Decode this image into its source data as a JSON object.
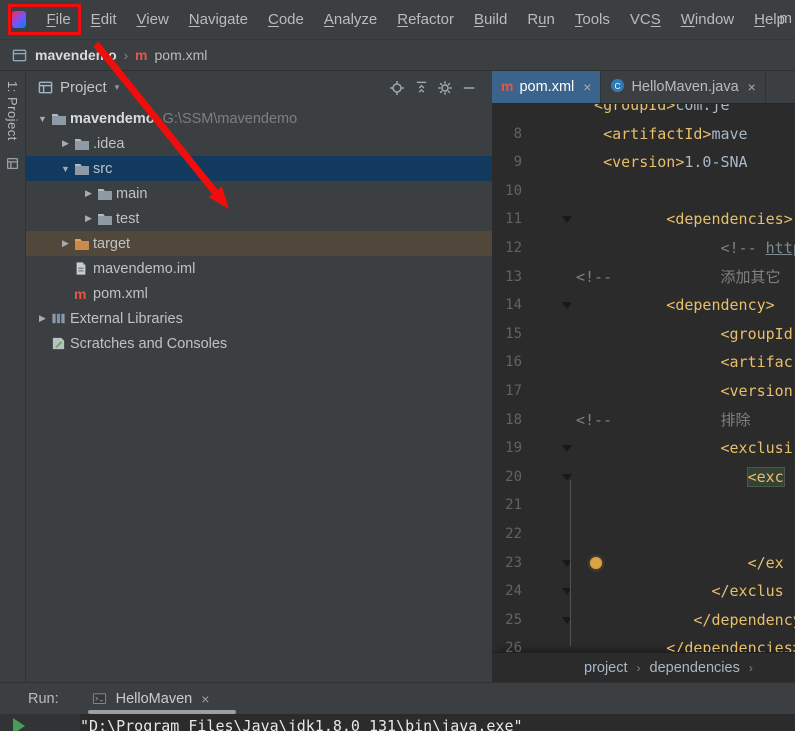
{
  "icons": {
    "close": "×",
    "chevron": "›",
    "caret": "▾",
    "expanded": "▼",
    "collapsed": "▶"
  },
  "menu": {
    "items": [
      {
        "label": "File",
        "mnemonic": "F"
      },
      {
        "label": "Edit",
        "mnemonic": "E"
      },
      {
        "label": "View",
        "mnemonic": "V"
      },
      {
        "label": "Navigate",
        "mnemonic": "N"
      },
      {
        "label": "Code",
        "mnemonic": "C"
      },
      {
        "label": "Analyze",
        "mnemonic": "A"
      },
      {
        "label": "Refactor",
        "mnemonic": "R"
      },
      {
        "label": "Build",
        "mnemonic": "B"
      },
      {
        "label": "Run",
        "mnemonic": "u"
      },
      {
        "label": "Tools",
        "mnemonic": "T"
      },
      {
        "label": "VCS",
        "mnemonic": "S"
      },
      {
        "label": "Window",
        "mnemonic": "W"
      },
      {
        "label": "Help",
        "mnemonic": "H"
      }
    ],
    "overflow": "m"
  },
  "breadcrumb": {
    "project": "mavendemo",
    "file": "pom.xml"
  },
  "stripe": {
    "project_label": "1: Project"
  },
  "project": {
    "title": "Project",
    "tree": [
      {
        "label": "mavendemo",
        "hint": "G:\\SSM\\mavendemo",
        "level": 0,
        "arrow": "down",
        "icon": "folder",
        "bold": true
      },
      {
        "label": ".idea",
        "level": 1,
        "arrow": "right",
        "icon": "folder"
      },
      {
        "label": "src",
        "level": 1,
        "arrow": "down",
        "icon": "folder",
        "state": "selected"
      },
      {
        "label": "main",
        "level": 2,
        "arrow": "right",
        "icon": "folder"
      },
      {
        "label": "test",
        "level": 2,
        "arrow": "right",
        "icon": "folder"
      },
      {
        "label": "target",
        "level": 1,
        "arrow": "right",
        "icon": "folder-excluded",
        "state": "excluded"
      },
      {
        "label": "mavendemo.iml",
        "level": 1,
        "arrow": "none",
        "icon": "file"
      },
      {
        "label": "pom.xml",
        "level": 1,
        "arrow": "none",
        "icon": "maven"
      },
      {
        "label": "External Libraries",
        "level": 0,
        "arrow": "right",
        "icon": "libraries"
      },
      {
        "label": "Scratches and Consoles",
        "level": 0,
        "arrow": "none",
        "icon": "scratches"
      }
    ]
  },
  "editor": {
    "tabs": [
      {
        "label": "pom.xml",
        "icon": "maven",
        "selected": true
      },
      {
        "label": "HelloMaven.java",
        "icon": "class",
        "selected": false
      }
    ],
    "lines": [
      {
        "num": "",
        "indent": 2,
        "segs": [
          [
            "<groupId>",
            "tag"
          ],
          [
            "com.je",
            "plain"
          ]
        ]
      },
      {
        "num": "8",
        "indent": 3,
        "segs": [
          [
            "<artifactId>",
            "tag"
          ],
          [
            "mave",
            "plain"
          ]
        ]
      },
      {
        "num": "9",
        "indent": 3,
        "segs": [
          [
            "<version>",
            "tag"
          ],
          [
            "1.0-SNA",
            "plain"
          ]
        ]
      },
      {
        "num": "10",
        "indent": 0,
        "segs": []
      },
      {
        "num": "11",
        "indent": 10,
        "fold": true,
        "segs": [
          [
            "<dependencies>",
            "tag"
          ]
        ]
      },
      {
        "num": "12",
        "indent": 16,
        "segs": [
          [
            "<!-- ",
            "comment"
          ],
          [
            "https:/",
            "link"
          ]
        ]
      },
      {
        "num": "13",
        "indent": 0,
        "segs": [
          [
            "<!--            添加其它",
            "comment"
          ]
        ]
      },
      {
        "num": "14",
        "indent": 10,
        "fold": true,
        "segs": [
          [
            "<dependency>",
            "tag"
          ]
        ]
      },
      {
        "num": "15",
        "indent": 16,
        "segs": [
          [
            "<groupId",
            "tag"
          ]
        ]
      },
      {
        "num": "16",
        "indent": 16,
        "segs": [
          [
            "<artifac",
            "tag"
          ]
        ]
      },
      {
        "num": "17",
        "indent": 16,
        "segs": [
          [
            "<version",
            "tag"
          ]
        ]
      },
      {
        "num": "18",
        "indent": 0,
        "segs": [
          [
            "<!--            排除",
            "comment"
          ]
        ]
      },
      {
        "num": "19",
        "indent": 16,
        "fold": true,
        "segs": [
          [
            "<exclusi",
            "tag"
          ]
        ]
      },
      {
        "num": "20",
        "indent": 19,
        "fold": true,
        "segs": [
          [
            "<exc",
            "tag-hl"
          ]
        ]
      },
      {
        "num": "21",
        "indent": 0,
        "segs": []
      },
      {
        "num": "22",
        "indent": 0,
        "segs": []
      },
      {
        "num": "23",
        "indent": 19,
        "fold": true,
        "bulb": true,
        "segs": [
          [
            "</ex",
            "tag"
          ]
        ]
      },
      {
        "num": "24",
        "indent": 15,
        "fold": true,
        "segs": [
          [
            "</exclus",
            "tag"
          ]
        ]
      },
      {
        "num": "25",
        "indent": 13,
        "fold": true,
        "segs": [
          [
            "</dependency",
            "tag"
          ]
        ]
      },
      {
        "num": "26",
        "indent": 10,
        "segs": [
          [
            "</dependencies>",
            "tag"
          ]
        ]
      }
    ],
    "breadcrumbs": [
      "project",
      "dependencies"
    ]
  },
  "run": {
    "label": "Run:",
    "tab": "HelloMaven",
    "close": "×",
    "console": "\"D:\\Program Files\\Java\\jdk1.8.0_131\\bin\\java.exe\""
  },
  "annotations": {
    "color": "#f20d0d"
  }
}
